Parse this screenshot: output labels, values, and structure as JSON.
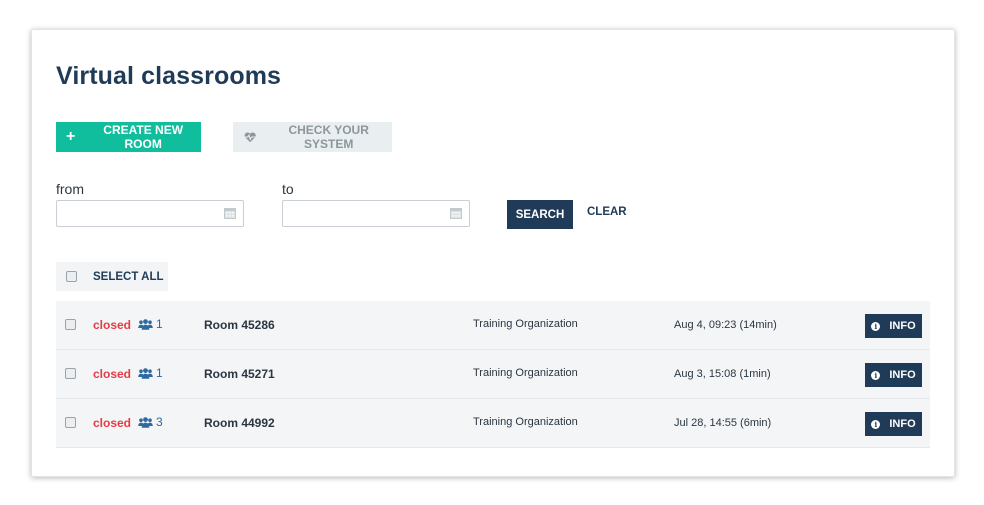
{
  "page": {
    "title": "Virtual classrooms"
  },
  "toolbar": {
    "create_label": "CREATE NEW ROOM",
    "create_icon": "plus-icon",
    "check_label": "CHECK YOUR SYSTEM",
    "check_icon": "heartbeat-icon"
  },
  "filters": {
    "from_label": "from",
    "from_value": "",
    "to_label": "to",
    "to_value": "",
    "calendar_icon": "calendar-icon",
    "search_label": "SEARCH",
    "clear_label": "CLEAR"
  },
  "select_all": {
    "label": "SELECT ALL",
    "checked": false
  },
  "rooms": [
    {
      "status": "closed",
      "participants": "1",
      "name": "Room 45286",
      "organization": "Training Organization",
      "date": "Aug 4, 09:23 (14min)",
      "info_label": "INFO"
    },
    {
      "status": "closed",
      "participants": "1",
      "name": "Room 45271",
      "organization": "Training Organization",
      "date": "Aug 3, 15:08 (1min)",
      "info_label": "INFO"
    },
    {
      "status": "closed",
      "participants": "3",
      "name": "Room 44992",
      "organization": "Training Organization",
      "date": "Jul 28, 14:55 (6min)",
      "info_label": "INFO"
    }
  ],
  "colors": {
    "accent": "#10bd9c",
    "primary": "#1f3b57",
    "status_closed": "#e63c47",
    "participants": "#2d6aa0"
  }
}
